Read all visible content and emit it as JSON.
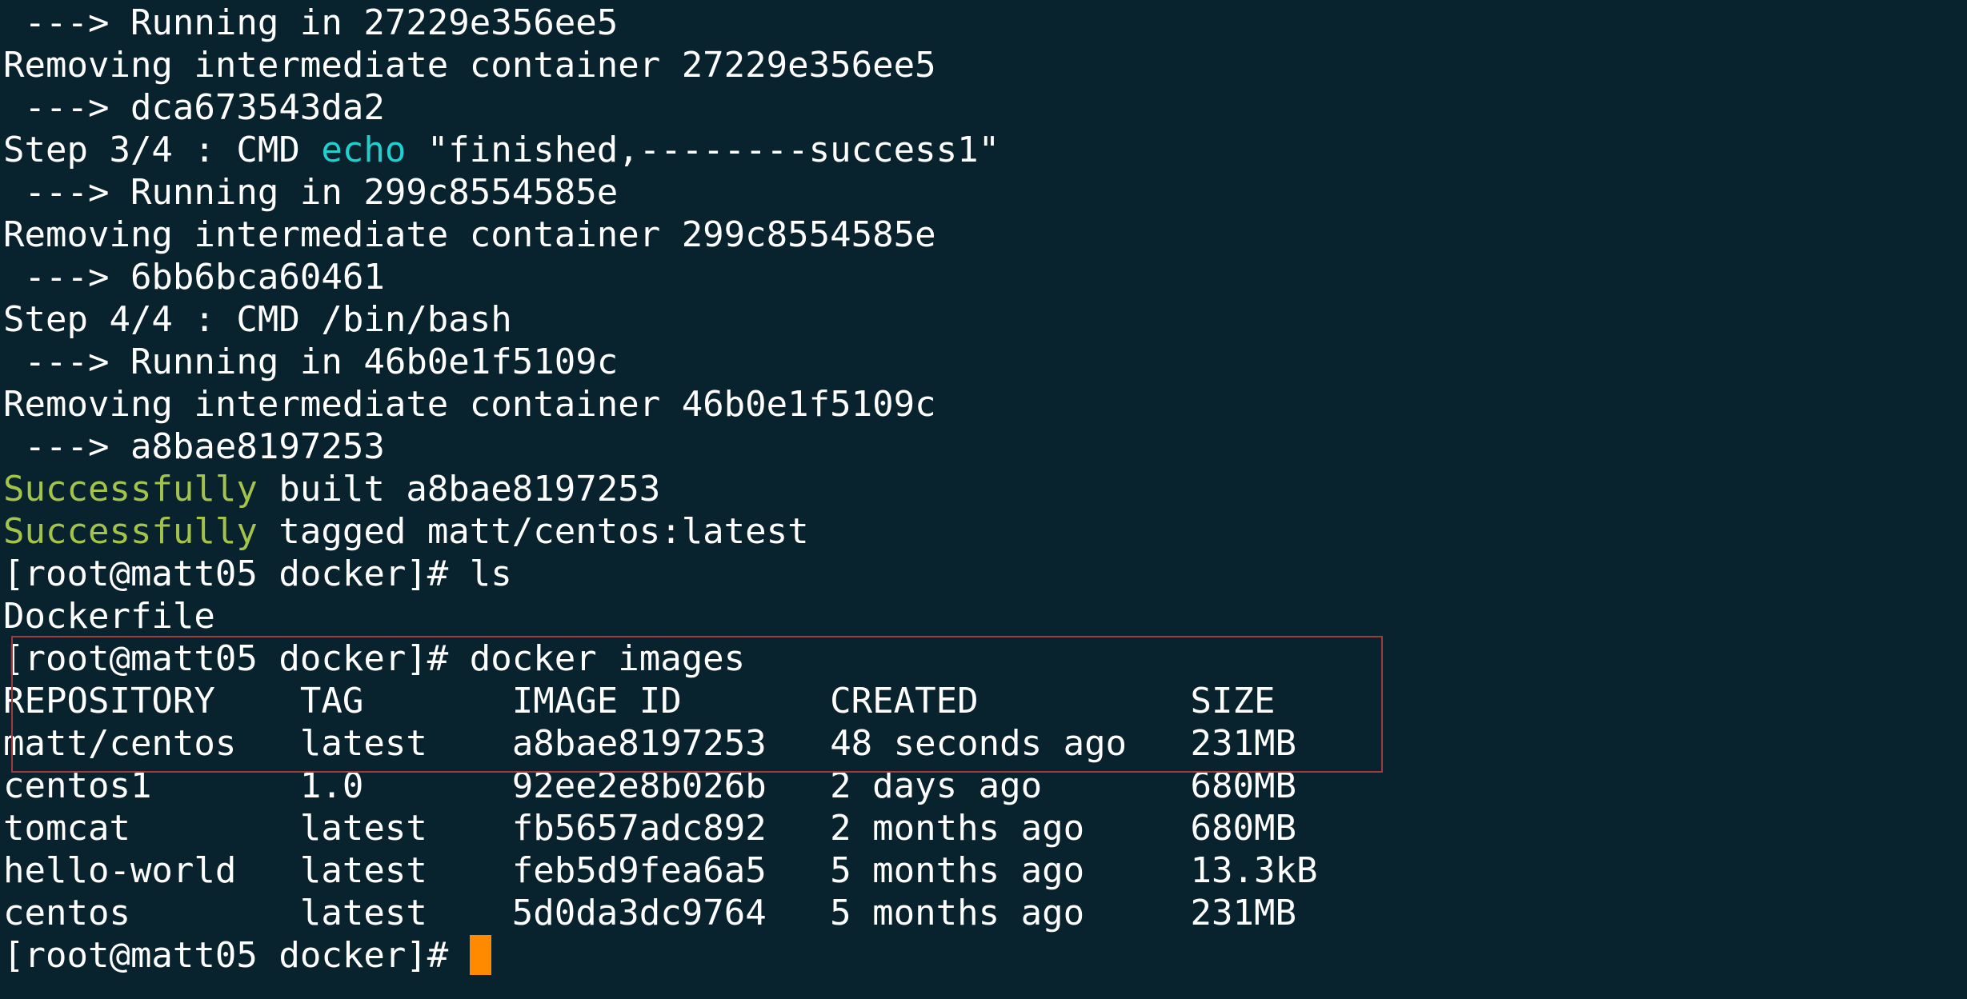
{
  "terminal": {
    "lines": [
      " ---> Running in 27229e356ee5",
      "Removing intermediate container 27229e356ee5",
      " ---> dca673543da2"
    ],
    "step3": {
      "prefix": "Step 3/4 : CMD ",
      "keyword": "echo",
      "rest": " \"finished,--------success1\""
    },
    "lines2": [
      " ---> Running in 299c8554585e",
      "Removing intermediate container 299c8554585e",
      " ---> 6bb6bca60461",
      "Step 4/4 : CMD /bin/bash",
      " ---> Running in 46b0e1f5109c",
      "Removing intermediate container 46b0e1f5109c",
      " ---> a8bae8197253"
    ],
    "success_built": {
      "keyword": "Successfully",
      "rest": " built a8bae8197253"
    },
    "success_tagged": {
      "keyword": "Successfully",
      "rest": " tagged matt/centos:latest"
    },
    "lines3": [
      "[root@matt05 docker]# ls",
      "Dockerfile",
      "[root@matt05 docker]# docker images"
    ],
    "images_table": {
      "headers": [
        "REPOSITORY",
        "TAG",
        "IMAGE ID",
        "CREATED",
        "SIZE"
      ],
      "rows": [
        [
          "matt/centos",
          "latest",
          "a8bae8197253",
          "48 seconds ago",
          "231MB"
        ],
        [
          "centos1",
          "1.0",
          "92ee2e8b026b",
          "2 days ago",
          "680MB"
        ],
        [
          "tomcat",
          "latest",
          "fb5657adc892",
          "2 months ago",
          "680MB"
        ],
        [
          "hello-world",
          "latest",
          "feb5d9fea6a5",
          "5 months ago",
          "13.3kB"
        ],
        [
          "centos",
          "latest",
          "5d0da3dc9764",
          "5 months ago",
          "231MB"
        ]
      ]
    },
    "prompt": "[root@matt05 docker]# ",
    "colors": {
      "background": "#08232d",
      "text": "#ffffff",
      "keyword_cyan": "#1fd0d0",
      "success_green": "#a4c34b",
      "cursor": "#ff8a00",
      "highlight_border": "#a03a3e"
    }
  }
}
